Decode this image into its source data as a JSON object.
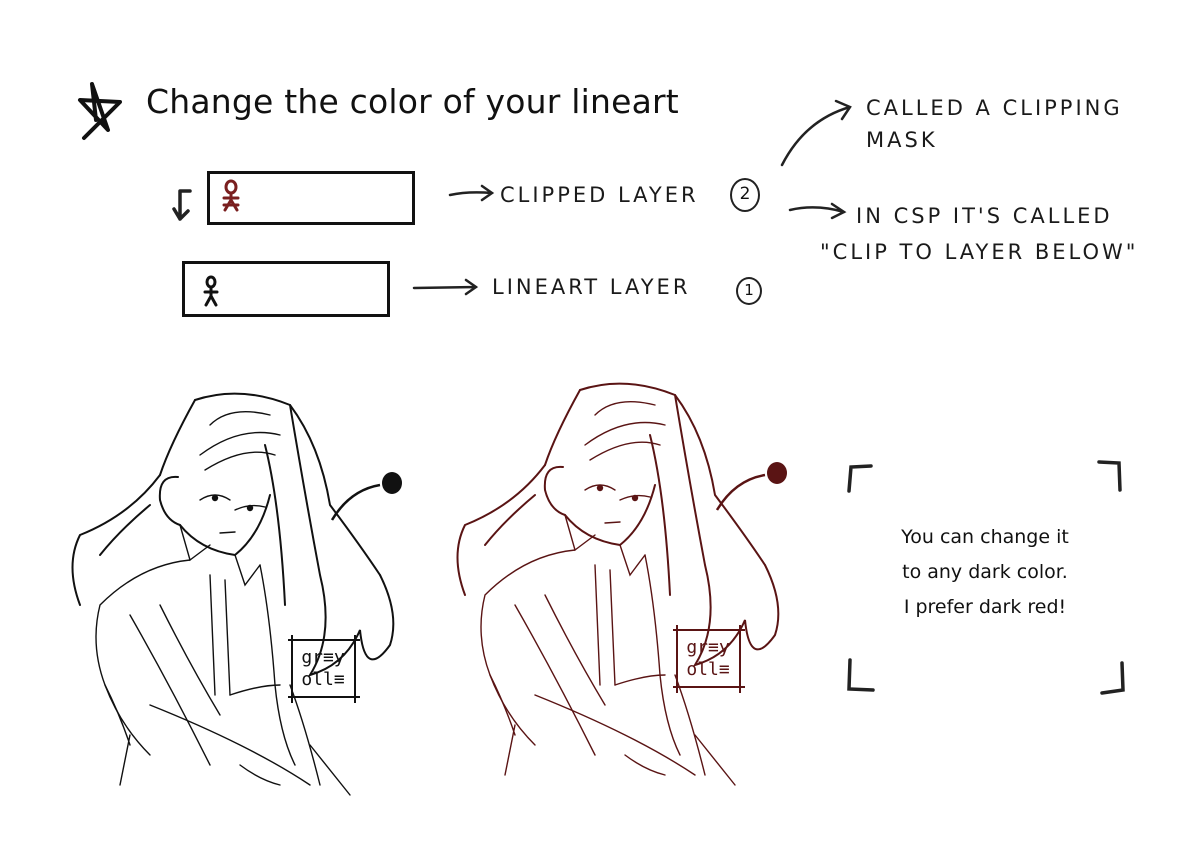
{
  "header": {
    "title": "Change the color of your lineart",
    "bullet_icon": "star-icon"
  },
  "layers_diagram": {
    "clipped_layer": {
      "label": "CLIPPED LAYER",
      "order_number": "2",
      "thumbnail_color": "#7a1f1f",
      "clip_indicator_icon": "down-arrow-icon"
    },
    "lineart_layer": {
      "label": "LINEART LAYER",
      "order_number": "1",
      "thumbnail_color": "#111111"
    }
  },
  "annotations": {
    "clipping_mask_note": [
      "CALLED A CLIPPING",
      "MASK"
    ],
    "csp_note": [
      "IN CSP IT'S CALLED",
      "\"CLIP TO LAYER BELOW\""
    ]
  },
  "illustrations": [
    {
      "name": "black-lineart",
      "line_color": "#111111",
      "signature": [
        "gr≡y",
        "oll≡"
      ]
    },
    {
      "name": "dark-red-lineart",
      "line_color": "#5a1414",
      "signature": [
        "gr≡y",
        "oll≡"
      ]
    }
  ],
  "tip_box": {
    "lines": [
      "You can change it",
      "to any dark color.",
      "I prefer dark red!"
    ]
  },
  "colors": {
    "ink": "#111111",
    "dark_red": "#5a1414",
    "background": "#ffffff"
  }
}
